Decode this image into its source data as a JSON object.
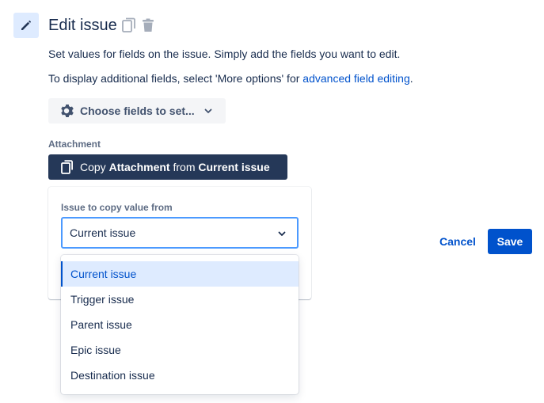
{
  "header": {
    "title": "Edit issue",
    "icon": "pencil-icon"
  },
  "description": {
    "line1": "Set values for fields on the issue. Simply add the fields you want to edit.",
    "line2_prefix": "To display additional fields, select 'More options' for ",
    "line2_link": "advanced field editing",
    "line2_suffix": "."
  },
  "choose_fields": {
    "label": "Choose fields to set...",
    "icon": "gear-icon"
  },
  "attachment": {
    "label": "Attachment",
    "copy_button": {
      "prefix": "Copy ",
      "field": "Attachment",
      "middle": " from ",
      "source": "Current issue"
    }
  },
  "copy_popup": {
    "label": "Issue to copy value from",
    "selected_value": "Current issue"
  },
  "actions": {
    "cancel": "Cancel",
    "save": "Save"
  },
  "dropdown": {
    "options": [
      "Current issue",
      "Trigger issue",
      "Parent issue",
      "Epic issue",
      "Destination issue"
    ],
    "selected_index": 0
  },
  "colors": {
    "primary": "#0052cc",
    "dark_button": "#253858",
    "selected_bg": "#deebff",
    "focus_border": "#4c9aff"
  }
}
